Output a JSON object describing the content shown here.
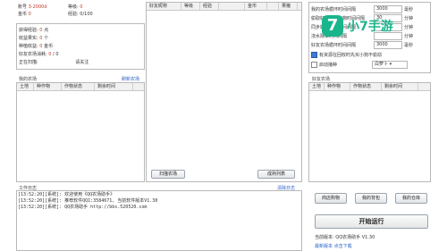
{
  "account": {
    "row1_label": "账号",
    "row1_value": "3-2000d",
    "row1b_label": "等级",
    "row1b_value": "0",
    "row2_label": "金币",
    "row2_value": "0",
    "row2b_label": "经验",
    "row2b_value": "0/100"
  },
  "stats": [
    {
      "label": "获得经验:",
      "value": "0",
      "unit": "点"
    },
    {
      "label": "收益果实:",
      "value": "0",
      "unit": "个"
    },
    {
      "label": "种植收益:",
      "value": "0",
      "unit": "金币"
    },
    {
      "label": "好友农场消耗:",
      "value": "0",
      "extra": "/",
      "value2": "0"
    },
    {
      "label": "正在扫描:",
      "value": "",
      "extra": "",
      "value2": "请关注"
    }
  ],
  "my_farm": {
    "title": "我的农场",
    "refresh": "刷新农场",
    "columns": [
      "土地",
      "种作物",
      "作物状态",
      "剩余时间"
    ]
  },
  "friends": {
    "columns": [
      "好友昵称",
      "等级",
      "经验",
      "",
      "金币",
      "",
      "果猪"
    ],
    "scan_button": "扫描农场",
    "result_button": "成熟列表"
  },
  "settings": {
    "rows": [
      {
        "label": "我的农场循环时间间隔",
        "value": "3000",
        "unit": "毫秒"
      },
      {
        "label": "偷取好友成熟作物时间间隔",
        "value": "30",
        "unit": "分钟"
      },
      {
        "label": "同步好友列表时间间隔",
        "value": "",
        "unit": "分钟"
      },
      {
        "label": "浇水除草时间间隔",
        "value": "",
        "unit": "分钟"
      },
      {
        "label": "好友农场循环时间间隔",
        "value": "3000",
        "unit": "毫秒"
      }
    ],
    "check1": "有资源在回收时先买小狗不偷窃",
    "check2": "启动播种",
    "seed_select": "白萝卜"
  },
  "friend_farm": {
    "title": "好友农场",
    "columns": [
      "土地",
      "种作物",
      "作物状态",
      "剩余时间"
    ]
  },
  "log": {
    "title": "工作日志",
    "clear": "清除日志",
    "lines": [
      "[13:52:20][系统]: 欢迎使用《QQ农场助手》",
      "[13:52:20][系统]: 推荐软件QQ1:3584671, 当前软件版本V1.30",
      "[13:52:20][系统]: QQ农场助手 http://bbs.520520.com"
    ]
  },
  "actions": {
    "buy_seed": "商店购物",
    "my_bag": "我的背包",
    "my_warehouse": "我的仓库",
    "start": "开始运行",
    "version_label": "当前版本:",
    "version_value": "QQ农场助手 V1.30",
    "update_label": "最新版本",
    "update_value": "点击下载"
  },
  "watermark": "7 小7手游",
  "colors": {
    "accent": "#2a62c9",
    "warn": "#c0392b",
    "watermark": "#19b58c"
  }
}
